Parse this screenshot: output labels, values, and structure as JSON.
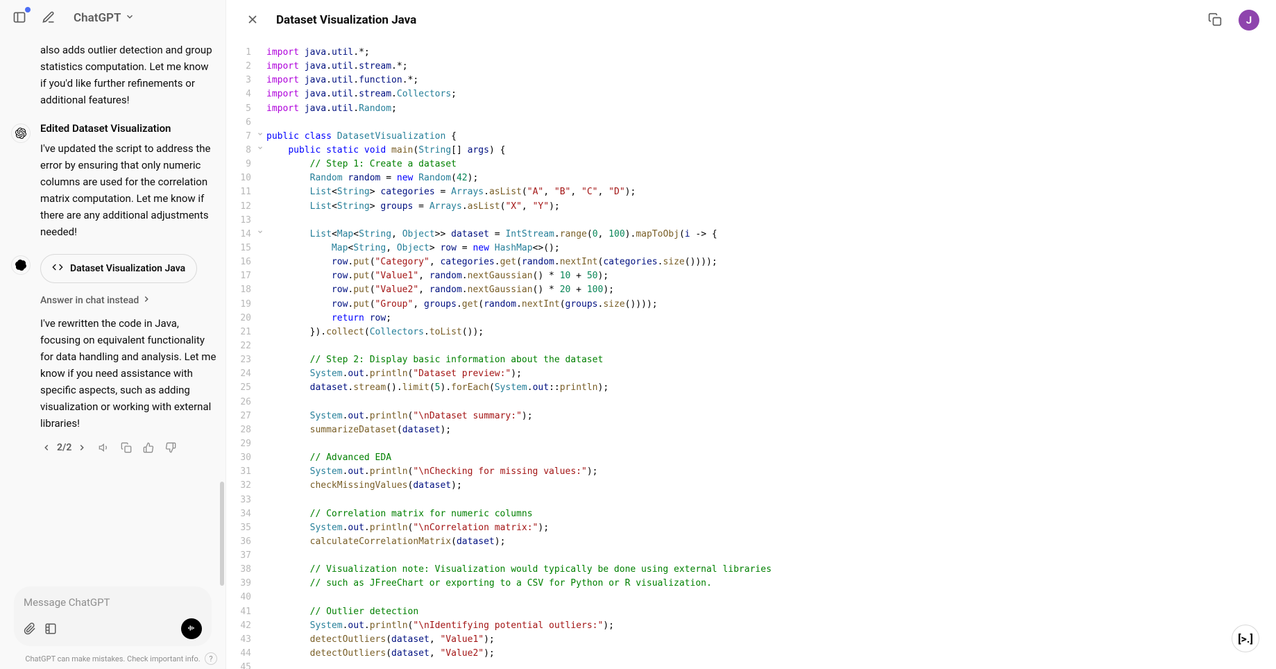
{
  "header": {
    "model_label": "ChatGPT",
    "main_title": "Dataset Visualization Java",
    "avatar_initial": "J"
  },
  "conversation": {
    "msg0_text": "also adds outlier detection and group statistics computation. Let me know if you'd like further refinements or additional features!",
    "msg1_title": "Edited Dataset Visualization",
    "msg1_text": "I've updated the script to address the error by ensuring that only numeric columns are used for the correlation matrix computation. Let me know if there are any additional adjustments needed!",
    "chip_label": "Dataset Visualization Java",
    "answer_link": "Answer in chat instead",
    "msg2_text": "I've rewritten the code in Java, focusing on equivalent functionality for data handling and analysis. Let me know if you need assistance with specific aspects, such as adding visualization or working with external libraries!",
    "pager": "2/2"
  },
  "input": {
    "placeholder": "Message ChatGPT"
  },
  "footer": {
    "disclaimer": "ChatGPT can make mistakes. Check important info.",
    "help": "?"
  },
  "fab_label": "[>.]",
  "code": [
    {
      "n": 1,
      "fold": "",
      "html": "<span class='k-import'>import</span> <span class='k-field'>java</span>.<span class='k-field'>util</span>.*;"
    },
    {
      "n": 2,
      "fold": "",
      "html": "<span class='k-import'>import</span> <span class='k-field'>java</span>.<span class='k-field'>util</span>.<span class='k-field'>stream</span>.*;"
    },
    {
      "n": 3,
      "fold": "",
      "html": "<span class='k-import'>import</span> <span class='k-field'>java</span>.<span class='k-field'>util</span>.<span class='k-field'>function</span>.*;"
    },
    {
      "n": 4,
      "fold": "",
      "html": "<span class='k-import'>import</span> <span class='k-field'>java</span>.<span class='k-field'>util</span>.<span class='k-field'>stream</span>.<span class='k-type'>Collectors</span>;"
    },
    {
      "n": 5,
      "fold": "",
      "html": "<span class='k-import'>import</span> <span class='k-field'>java</span>.<span class='k-field'>util</span>.<span class='k-type'>Random</span>;"
    },
    {
      "n": 6,
      "fold": "",
      "html": ""
    },
    {
      "n": 7,
      "fold": "v",
      "html": "<span class='k-keyword'>public</span> <span class='k-keyword'>class</span> <span class='k-type'>DatasetVisualization</span> {"
    },
    {
      "n": 8,
      "fold": "v",
      "html": "    <span class='k-keyword'>public</span> <span class='k-keyword'>static</span> <span class='k-keyword'>void</span> <span class='k-method'>main</span>(<span class='k-type'>String</span>[] <span class='k-field'>args</span>) {"
    },
    {
      "n": 9,
      "fold": "",
      "html": "        <span class='k-comment'>// Step 1: Create a dataset</span>"
    },
    {
      "n": 10,
      "fold": "",
      "html": "        <span class='k-type'>Random</span> <span class='k-field'>random</span> = <span class='k-keyword'>new</span> <span class='k-type'>Random</span>(<span class='k-num'>42</span>);"
    },
    {
      "n": 11,
      "fold": "",
      "html": "        <span class='k-type'>List</span>&lt;<span class='k-type'>String</span>&gt; <span class='k-field'>categories</span> = <span class='k-type'>Arrays</span>.<span class='k-method'>asList</span>(<span class='k-string'>\"A\"</span>, <span class='k-string'>\"B\"</span>, <span class='k-string'>\"C\"</span>, <span class='k-string'>\"D\"</span>);"
    },
    {
      "n": 12,
      "fold": "",
      "html": "        <span class='k-type'>List</span>&lt;<span class='k-type'>String</span>&gt; <span class='k-field'>groups</span> = <span class='k-type'>Arrays</span>.<span class='k-method'>asList</span>(<span class='k-string'>\"X\"</span>, <span class='k-string'>\"Y\"</span>);"
    },
    {
      "n": 13,
      "fold": "",
      "html": ""
    },
    {
      "n": 14,
      "fold": "v",
      "html": "        <span class='k-type'>List</span>&lt;<span class='k-type'>Map</span>&lt;<span class='k-type'>String</span>, <span class='k-type'>Object</span>&gt;&gt; <span class='k-field'>dataset</span> = <span class='k-type'>IntStream</span>.<span class='k-method'>range</span>(<span class='k-num'>0</span>, <span class='k-num'>100</span>).<span class='k-method'>mapToObj</span>(<span class='k-field'>i</span> -&gt; {"
    },
    {
      "n": 15,
      "fold": "",
      "html": "            <span class='k-type'>Map</span>&lt;<span class='k-type'>String</span>, <span class='k-type'>Object</span>&gt; <span class='k-field'>row</span> = <span class='k-keyword'>new</span> <span class='k-type'>HashMap</span>&lt;&gt;();"
    },
    {
      "n": 16,
      "fold": "",
      "html": "            <span class='k-field'>row</span>.<span class='k-method'>put</span>(<span class='k-string'>\"Category\"</span>, <span class='k-field'>categories</span>.<span class='k-method'>get</span>(<span class='k-field'>random</span>.<span class='k-method'>nextInt</span>(<span class='k-field'>categories</span>.<span class='k-method'>size</span>())));"
    },
    {
      "n": 17,
      "fold": "",
      "html": "            <span class='k-field'>row</span>.<span class='k-method'>put</span>(<span class='k-string'>\"Value1\"</span>, <span class='k-field'>random</span>.<span class='k-method'>nextGaussian</span>() * <span class='k-num'>10</span> + <span class='k-num'>50</span>);"
    },
    {
      "n": 18,
      "fold": "",
      "html": "            <span class='k-field'>row</span>.<span class='k-method'>put</span>(<span class='k-string'>\"Value2\"</span>, <span class='k-field'>random</span>.<span class='k-method'>nextGaussian</span>() * <span class='k-num'>20</span> + <span class='k-num'>100</span>);"
    },
    {
      "n": 19,
      "fold": "",
      "html": "            <span class='k-field'>row</span>.<span class='k-method'>put</span>(<span class='k-string'>\"Group\"</span>, <span class='k-field'>groups</span>.<span class='k-method'>get</span>(<span class='k-field'>random</span>.<span class='k-method'>nextInt</span>(<span class='k-field'>groups</span>.<span class='k-method'>size</span>())));"
    },
    {
      "n": 20,
      "fold": "",
      "html": "            <span class='k-keyword'>return</span> <span class='k-field'>row</span>;"
    },
    {
      "n": 21,
      "fold": "",
      "html": "        }).<span class='k-method'>collect</span>(<span class='k-type'>Collectors</span>.<span class='k-method'>toList</span>());"
    },
    {
      "n": 22,
      "fold": "",
      "html": ""
    },
    {
      "n": 23,
      "fold": "",
      "html": "        <span class='k-comment'>// Step 2: Display basic information about the dataset</span>"
    },
    {
      "n": 24,
      "fold": "",
      "html": "        <span class='k-type'>System</span>.<span class='k-field'>out</span>.<span class='k-method'>println</span>(<span class='k-string'>\"Dataset preview:\"</span>);"
    },
    {
      "n": 25,
      "fold": "",
      "html": "        <span class='k-field'>dataset</span>.<span class='k-method'>stream</span>().<span class='k-method'>limit</span>(<span class='k-num'>5</span>).<span class='k-method'>forEach</span>(<span class='k-type'>System</span>.<span class='k-field'>out</span>::<span class='k-method'>println</span>);"
    },
    {
      "n": 26,
      "fold": "",
      "html": ""
    },
    {
      "n": 27,
      "fold": "",
      "html": "        <span class='k-type'>System</span>.<span class='k-field'>out</span>.<span class='k-method'>println</span>(<span class='k-string'>\"\\nDataset summary:\"</span>);"
    },
    {
      "n": 28,
      "fold": "",
      "html": "        <span class='k-method'>summarizeDataset</span>(<span class='k-field'>dataset</span>);"
    },
    {
      "n": 29,
      "fold": "",
      "html": ""
    },
    {
      "n": 30,
      "fold": "",
      "html": "        <span class='k-comment'>// Advanced EDA</span>"
    },
    {
      "n": 31,
      "fold": "",
      "html": "        <span class='k-type'>System</span>.<span class='k-field'>out</span>.<span class='k-method'>println</span>(<span class='k-string'>\"\\nChecking for missing values:\"</span>);"
    },
    {
      "n": 32,
      "fold": "",
      "html": "        <span class='k-method'>checkMissingValues</span>(<span class='k-field'>dataset</span>);"
    },
    {
      "n": 33,
      "fold": "",
      "html": ""
    },
    {
      "n": 34,
      "fold": "",
      "html": "        <span class='k-comment'>// Correlation matrix for numeric columns</span>"
    },
    {
      "n": 35,
      "fold": "",
      "html": "        <span class='k-type'>System</span>.<span class='k-field'>out</span>.<span class='k-method'>println</span>(<span class='k-string'>\"\\nCorrelation matrix:\"</span>);"
    },
    {
      "n": 36,
      "fold": "",
      "html": "        <span class='k-method'>calculateCorrelationMatrix</span>(<span class='k-field'>dataset</span>);"
    },
    {
      "n": 37,
      "fold": "",
      "html": ""
    },
    {
      "n": 38,
      "fold": "",
      "html": "        <span class='k-comment'>// Visualization note: Visualization would typically be done using external libraries</span>"
    },
    {
      "n": 39,
      "fold": "",
      "html": "        <span class='k-comment'>// such as JFreeChart or exporting to a CSV for Python or R visualization.</span>"
    },
    {
      "n": 40,
      "fold": "",
      "html": ""
    },
    {
      "n": 41,
      "fold": "",
      "html": "        <span class='k-comment'>// Outlier detection</span>"
    },
    {
      "n": 42,
      "fold": "",
      "html": "        <span class='k-type'>System</span>.<span class='k-field'>out</span>.<span class='k-method'>println</span>(<span class='k-string'>\"\\nIdentifying potential outliers:\"</span>);"
    },
    {
      "n": 43,
      "fold": "",
      "html": "        <span class='k-method'>detectOutliers</span>(<span class='k-field'>dataset</span>, <span class='k-string'>\"Value1\"</span>);"
    },
    {
      "n": 44,
      "fold": "",
      "html": "        <span class='k-method'>detectOutliers</span>(<span class='k-field'>dataset</span>, <span class='k-string'>\"Value2\"</span>);"
    },
    {
      "n": 45,
      "fold": "",
      "html": ""
    }
  ]
}
